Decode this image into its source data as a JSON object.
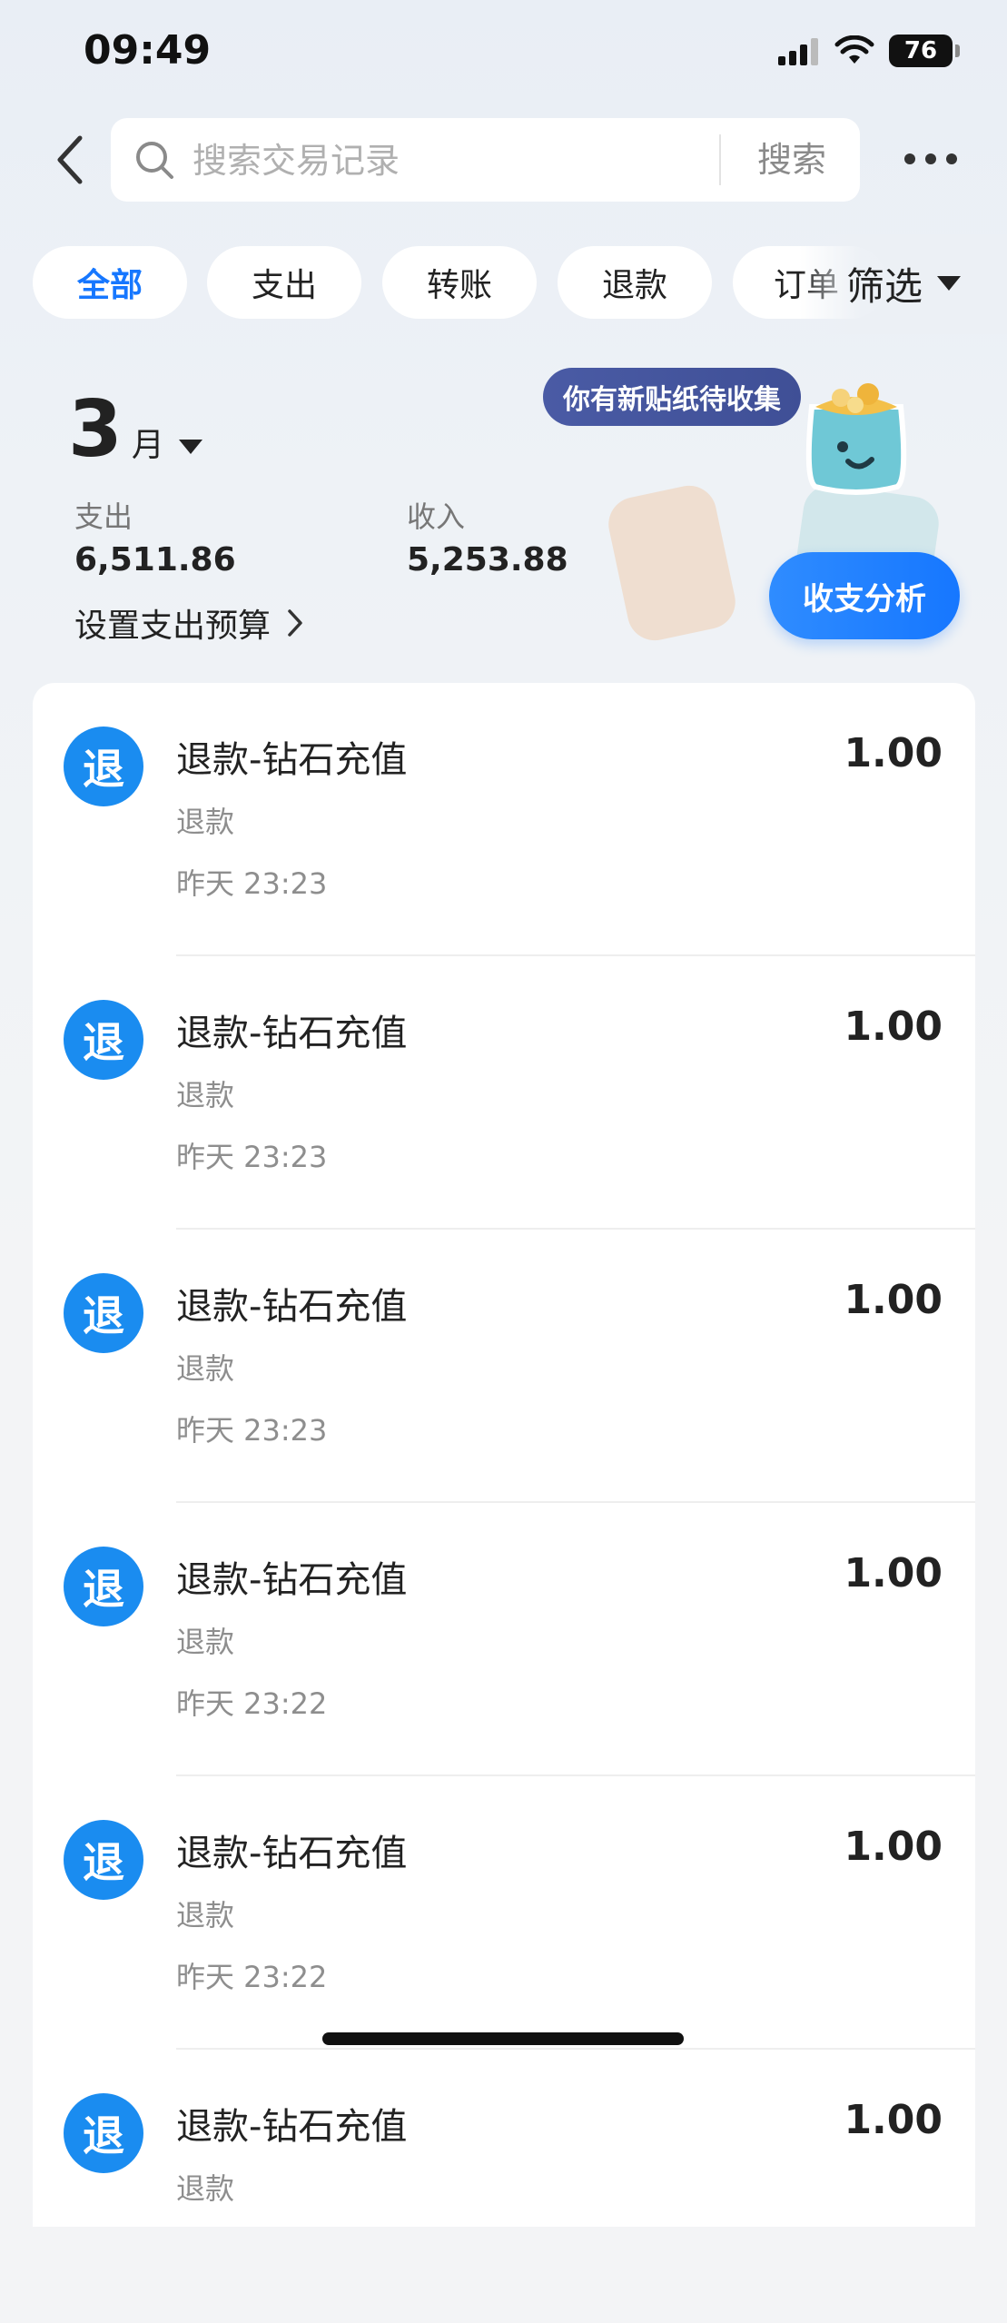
{
  "status_bar": {
    "time": "09:49",
    "battery": "76"
  },
  "header": {
    "search_placeholder": "搜索交易记录",
    "search_button": "搜索"
  },
  "tabs": [
    {
      "label": "全部",
      "active": true
    },
    {
      "label": "支出",
      "active": false
    },
    {
      "label": "转账",
      "active": false
    },
    {
      "label": "退款",
      "active": false
    },
    {
      "label": "订单",
      "active": false
    }
  ],
  "filter": {
    "label": "筛选"
  },
  "summary": {
    "month_number": "3",
    "month_unit": "月",
    "expense_label": "支出",
    "expense_value": "6,511.86",
    "income_label": "收入",
    "income_value": "5,253.88",
    "budget_link": "设置支出预算",
    "analysis_button": "收支分析",
    "sticker_bubble": "你有新贴纸待收集"
  },
  "transactions": [
    {
      "icon_char": "退",
      "title": "退款-钻石充值",
      "type": "退款",
      "time": "昨天 23:23",
      "amount": "1.00"
    },
    {
      "icon_char": "退",
      "title": "退款-钻石充值",
      "type": "退款",
      "time": "昨天 23:23",
      "amount": "1.00"
    },
    {
      "icon_char": "退",
      "title": "退款-钻石充值",
      "type": "退款",
      "time": "昨天 23:23",
      "amount": "1.00"
    },
    {
      "icon_char": "退",
      "title": "退款-钻石充值",
      "type": "退款",
      "time": "昨天 23:22",
      "amount": "1.00"
    },
    {
      "icon_char": "退",
      "title": "退款-钻石充值",
      "type": "退款",
      "time": "昨天 23:22",
      "amount": "1.00"
    },
    {
      "icon_char": "退",
      "title": "退款-钻石充值",
      "type": "退款",
      "time": "",
      "amount": "1.00"
    }
  ],
  "colors": {
    "accent": "#1677ff",
    "refund_icon": "#1a8cf0"
  }
}
